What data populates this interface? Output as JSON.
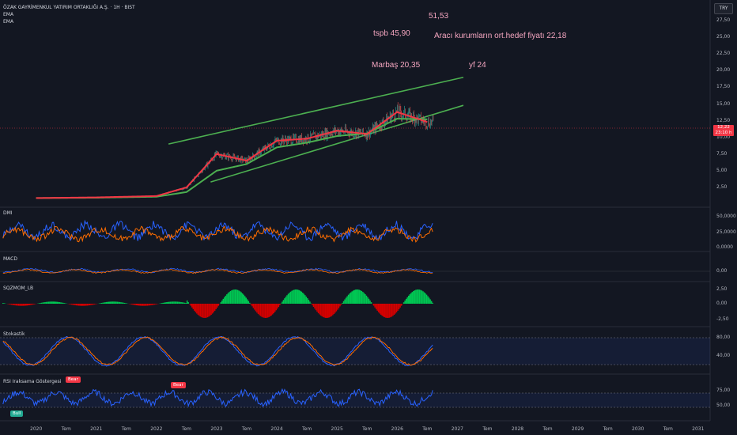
{
  "chart": {
    "title": "ÖZAK GAYRİMENKUL YATIRIM ORTAKLIĞI A.Ş. · 1H · BIST",
    "indicators": [
      "EMA",
      "EMA"
    ],
    "currency": "TRY",
    "last_price": "12,22",
    "last_price_sub": "23:10 h"
  },
  "annotations": [
    {
      "text": "51,53"
    },
    {
      "text": "tspb 45,90"
    },
    {
      "text": "Aracı kurumların ort.hedef fiyatı 22,18"
    },
    {
      "text": "Marbaş 20,35"
    },
    {
      "text": "yf 24"
    }
  ],
  "panes": {
    "dmi": {
      "label": "DMI",
      "ticks": [
        "50,0000",
        "25,0000",
        "0,0000"
      ]
    },
    "macd": {
      "label": "MACD",
      "ticks": [
        "0,00"
      ]
    },
    "sqzmom": {
      "label": "SQZMOM_LB",
      "ticks": [
        "2,50",
        "0,00",
        "-2,50"
      ]
    },
    "stoch": {
      "label": "Stokastik",
      "ticks": [
        "80,00",
        "40,00"
      ]
    },
    "rsi": {
      "label": "RSI Iraksama Göstergesi",
      "ticks": [
        "75,00",
        "50,00"
      ],
      "signals": [
        {
          "text": "Bear",
          "color": "#f23645"
        },
        {
          "text": "Bear",
          "color": "#f23645"
        },
        {
          "text": "Bull",
          "color": "#22ab94"
        }
      ]
    }
  },
  "price_axis": [
    "27,50",
    "25,00",
    "22,50",
    "20,00",
    "17,50",
    "15,00",
    "12,50",
    "10,00",
    "7,50",
    "5,00",
    "2,50"
  ],
  "time_axis": [
    "2020",
    "Tem",
    "2021",
    "Tem",
    "2022",
    "Tem",
    "2023",
    "Tem",
    "2024",
    "Tem",
    "2025",
    "Tem",
    "2026",
    "Tem",
    "2027",
    "Tem",
    "2028",
    "Tem",
    "2029",
    "Tem",
    "2030",
    "Tem",
    "2031"
  ],
  "colors": {
    "ema_fast": "#f23645",
    "ema_slow": "#4caf50",
    "channel": "#4caf50",
    "dmi_plus": "#2962ff",
    "dmi_minus": "#ff6d00",
    "rsi": "#2962ff",
    "stoch_k": "#2962ff",
    "stoch_d": "#ff6d00"
  },
  "chart_data": {
    "type": "line",
    "series": [
      {
        "name": "EMA",
        "x": [
          2020.0,
          2021.0,
          2022.0,
          2022.5,
          2023.0,
          2023.5,
          2024.0,
          2024.5,
          2025.0,
          2025.5,
          2026.0,
          2026.5
        ],
        "values": [
          0.9,
          1.0,
          1.2,
          2.5,
          7.5,
          6.5,
          9.5,
          9.8,
          11.0,
          10.5,
          13.8,
          12.3
        ]
      },
      {
        "name": "EMA",
        "x": [
          2020.0,
          2021.0,
          2022.0,
          2022.5,
          2023.0,
          2023.5,
          2024.0,
          2024.5,
          2025.0,
          2025.5,
          2026.0,
          2026.5
        ],
        "values": [
          0.9,
          0.95,
          1.1,
          1.8,
          5.0,
          6.0,
          8.5,
          9.2,
          10.2,
          10.6,
          12.8,
          12.7
        ]
      }
    ],
    "channel": {
      "upper": [
        [
          2022.2,
          9.0
        ],
        [
          2027.1,
          19.0
        ]
      ],
      "lower": [
        [
          2022.9,
          3.3
        ],
        [
          2027.1,
          14.8
        ]
      ]
    },
    "ylim": [
      0,
      30
    ],
    "xlim": [
      2019.4,
      2031.2
    ]
  }
}
